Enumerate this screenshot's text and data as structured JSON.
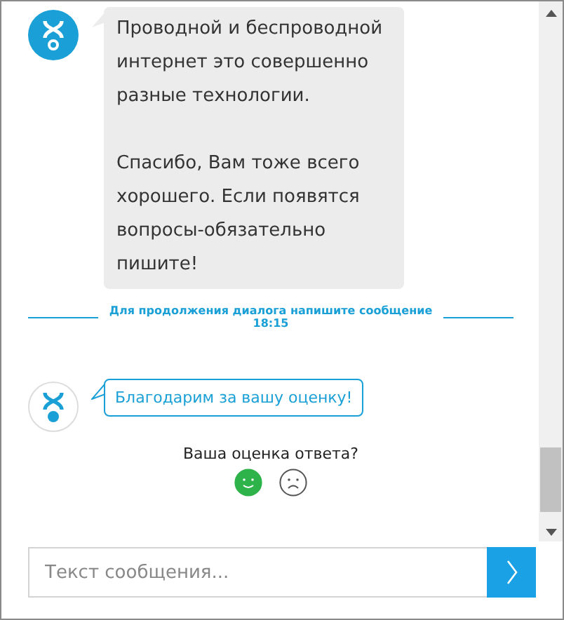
{
  "messages": [
    {
      "kind": "message",
      "paragraphs": [
        "Проводной и беспроводной интернет это совершенно разные технологии.",
        "Спасибо, Вам тоже всего хорошего. Если появятся вопросы-обязательно пишите!"
      ]
    },
    {
      "kind": "divider",
      "text": "Для продолжения диалога напишите сообщение",
      "time": "18:15"
    },
    {
      "kind": "notice",
      "paragraphs": [
        "Благодарим за вашу оценку!"
      ]
    },
    {
      "kind": "rating",
      "question": "Ваша оценка ответа?",
      "options": [
        {
          "kind": "positive",
          "selected": true
        },
        {
          "kind": "negative",
          "selected": false
        }
      ]
    }
  ],
  "composer": {
    "placeholder": "Текст сообщения..."
  }
}
